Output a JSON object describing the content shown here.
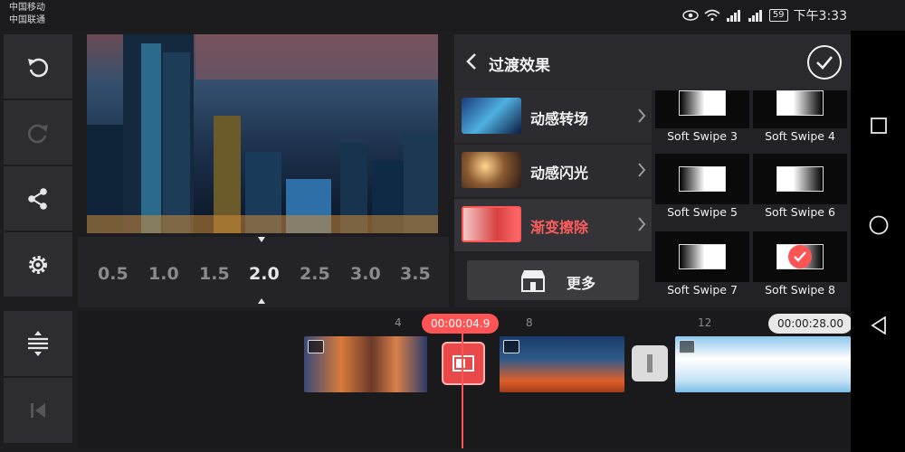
{
  "status_bar": {
    "carrier_1": "中国移动",
    "carrier_2": "中国联通",
    "battery": "59",
    "time": "下午3:33"
  },
  "preview": {
    "speed_options": [
      "0.5",
      "1.0",
      "1.5",
      "2.0",
      "2.5",
      "3.0",
      "3.5"
    ],
    "selected_speed": "2.0"
  },
  "transition_panel": {
    "title": "过渡效果",
    "categories": [
      {
        "label": "动感转场",
        "active": false
      },
      {
        "label": "动感闪光",
        "active": false
      },
      {
        "label": "渐变擦除",
        "active": true
      }
    ],
    "more_label": "更多",
    "effects": [
      {
        "label": "Soft Swipe 3",
        "selected": false
      },
      {
        "label": "Soft Swipe 4",
        "selected": false
      },
      {
        "label": "Soft Swipe 5",
        "selected": false
      },
      {
        "label": "Soft Swipe 6",
        "selected": false
      },
      {
        "label": "Soft Swipe 7",
        "selected": false
      },
      {
        "label": "Soft Swipe 8",
        "selected": true
      }
    ]
  },
  "timeline": {
    "ruler_marks": [
      "4",
      "8",
      "12"
    ],
    "current_time": "00:00:04.9",
    "total_time": "00:00:28.00"
  },
  "colors": {
    "accent": "#ff5454",
    "panel_bg": "#222226",
    "tool_bg": "#2c2c31"
  }
}
